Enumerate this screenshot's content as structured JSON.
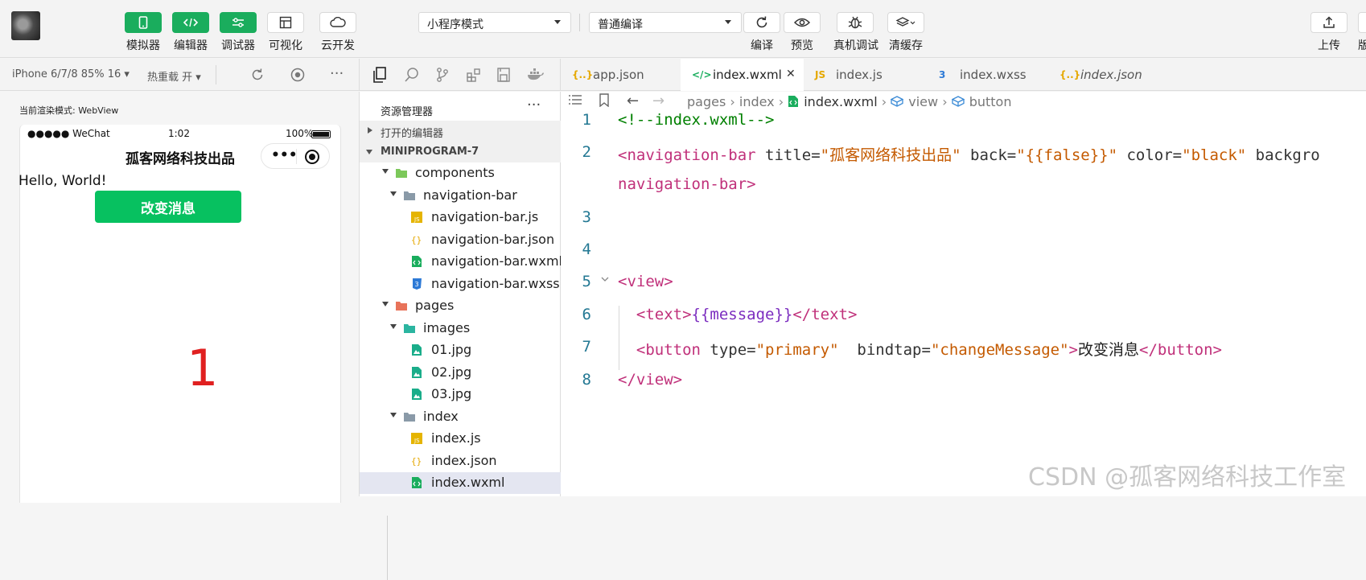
{
  "toolbar": {
    "buttons": [
      {
        "label": "模拟器",
        "icon": "phone-icon"
      },
      {
        "label": "编辑器",
        "icon": "code-icon"
      },
      {
        "label": "调试器",
        "icon": "sliders-icon"
      },
      {
        "label": "可视化",
        "icon": "layout-icon"
      },
      {
        "label": "云开发",
        "icon": "cloud-icon"
      }
    ],
    "mode_select": "小程序模式",
    "compile_select": "普通编译",
    "actions": [
      {
        "label": "编译",
        "icon": "refresh-icon"
      },
      {
        "label": "预览",
        "icon": "eye-icon"
      },
      {
        "label": "真机调试",
        "icon": "bug-icon"
      },
      {
        "label": "清缓存",
        "icon": "layers-icon"
      }
    ],
    "right": [
      {
        "label": "上传",
        "icon": "upload-icon"
      },
      {
        "label": "版"
      }
    ]
  },
  "simulator": {
    "device": "iPhone 6/7/8 85% 16 ▾",
    "hot_reload": "热重载 开 ▾",
    "render_mode": "当前渲染模式: WebView",
    "status": {
      "signal": "●●●●● WeChat",
      "time": "1:02",
      "battery": "100%"
    },
    "nav_title": "孤客网络科技出品",
    "capsule_dots": "•••",
    "hello": "Hello, World!",
    "button_label": "改变消息",
    "big_number": "1"
  },
  "explorer": {
    "title": "资源管理器",
    "more": "···",
    "open_editors": "打开的编辑器",
    "project": "MINIPROGRAM-7",
    "tree": [
      {
        "name": "components",
        "type": "folder-green",
        "open": true,
        "level": 1
      },
      {
        "name": "navigation-bar",
        "type": "folder",
        "open": true,
        "level": 2
      },
      {
        "name": "navigation-bar.js",
        "type": "js",
        "level": 3
      },
      {
        "name": "navigation-bar.json",
        "type": "json",
        "level": 3
      },
      {
        "name": "navigation-bar.wxml",
        "type": "wxml",
        "level": 3
      },
      {
        "name": "navigation-bar.wxss",
        "type": "wxss",
        "level": 3
      },
      {
        "name": "pages",
        "type": "folder-red",
        "open": true,
        "level": 1
      },
      {
        "name": "images",
        "type": "folder-teal",
        "open": true,
        "level": 2
      },
      {
        "name": "01.jpg",
        "type": "img",
        "level": 3
      },
      {
        "name": "02.jpg",
        "type": "img",
        "level": 3
      },
      {
        "name": "03.jpg",
        "type": "img",
        "level": 3
      },
      {
        "name": "index",
        "type": "folder",
        "open": true,
        "level": 2
      },
      {
        "name": "index.js",
        "type": "js",
        "level": 3
      },
      {
        "name": "index.json",
        "type": "json",
        "level": 3
      },
      {
        "name": "index.wxml",
        "type": "wxml",
        "level": 3,
        "selected": true
      }
    ]
  },
  "tabs": [
    {
      "label": "app.json",
      "icon": "{..}",
      "icon_color": "#e5a800"
    },
    {
      "label": "index.wxml",
      "icon": "</>",
      "icon_color": "#1aad5d",
      "active": true,
      "close": "✕"
    },
    {
      "label": "index.js",
      "icon": "JS",
      "icon_color": "#e5a800"
    },
    {
      "label": "index.wxss",
      "icon": "3",
      "icon_color": "#2d7ad6"
    },
    {
      "label": "index.json",
      "icon": "{..}",
      "icon_color": "#e5a800",
      "italic": true
    }
  ],
  "breadcrumb": [
    "pages",
    "index",
    "index.wxml",
    "view",
    "button"
  ],
  "code": [
    {
      "n": "1",
      "parts": [
        [
          "c-comment",
          "<!--index.wxml-->"
        ]
      ]
    },
    {
      "n": "2",
      "parts": [
        [
          "c-tag",
          "<navigation-bar"
        ],
        [
          "c-attr",
          " title="
        ],
        [
          "c-val",
          "\"孤客网络科技出品\""
        ],
        [
          "c-attr",
          " back="
        ],
        [
          "c-val",
          "\"{{false}}\""
        ],
        [
          "c-attr",
          " color="
        ],
        [
          "c-val",
          "\"black\""
        ],
        [
          "c-attr",
          " backgro"
        ]
      ]
    },
    {
      "n": "",
      "parts": [
        [
          "c-tag",
          "navigation-bar>"
        ]
      ]
    },
    {
      "n": "3",
      "parts": []
    },
    {
      "n": "4",
      "parts": []
    },
    {
      "n": "5",
      "parts": [
        [
          "c-tag",
          "<view>"
        ]
      ]
    },
    {
      "n": "6",
      "parts": [
        [
          "c-tag",
          "  <text>"
        ],
        [
          "c-mus",
          "{{message}}"
        ],
        [
          "c-tag",
          "</text>"
        ]
      ]
    },
    {
      "n": "7",
      "parts": [
        [
          "c-tag",
          "  <button"
        ],
        [
          "c-attr",
          " type="
        ],
        [
          "c-val",
          "\"primary\""
        ],
        [
          "c-attr",
          "  bindtap="
        ],
        [
          "c-val",
          "\"changeMessage\""
        ],
        [
          "c-tag",
          ">"
        ],
        [
          "c-plain",
          "改变消息"
        ],
        [
          "c-tag",
          "</button>"
        ]
      ]
    },
    {
      "n": "8",
      "parts": [
        [
          "c-tag",
          "</view>"
        ]
      ]
    }
  ],
  "watermark": "CSDN @孤客网络科技工作室"
}
